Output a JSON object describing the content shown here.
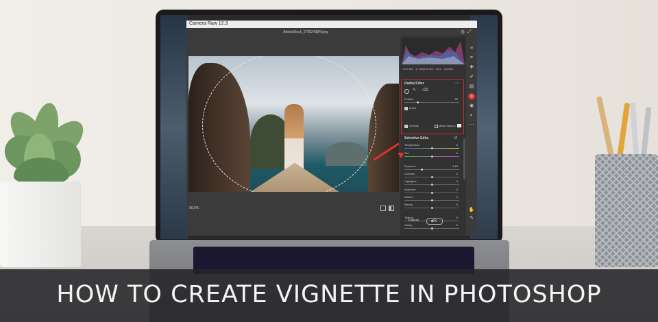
{
  "banner": {
    "title": "HOW TO CREATE VIGNETTE IN PHOTOSHOP"
  },
  "window": {
    "title": "Camera Raw 12.3",
    "filename": "AdobeStock_270524384.jpeg"
  },
  "meta": {
    "iso": "ISO 400",
    "lens": "17-40@28 mm",
    "aperture": "f/5.6",
    "shutter": "1/1250s"
  },
  "radial_filter": {
    "title": "Radial Filter",
    "feather_label": "Feather",
    "feather_value": "20",
    "invert_label": "Invert",
    "overlay_label": "Overlay",
    "mask_options_label": "Mask Options"
  },
  "selective_edits": {
    "title": "Selective Edits",
    "rows": [
      {
        "label": "Temperature",
        "value": "0"
      },
      {
        "label": "Tint",
        "value": "0"
      },
      {
        "label": "Exposure",
        "value": "-1.15"
      },
      {
        "label": "Contrast",
        "value": "0"
      },
      {
        "label": "Highlights",
        "value": "0"
      },
      {
        "label": "Shadows",
        "value": "0"
      },
      {
        "label": "Whites",
        "value": "0"
      },
      {
        "label": "Blacks",
        "value": "0"
      },
      {
        "label": "Texture",
        "value": "0"
      },
      {
        "label": "Clarity",
        "value": "0"
      }
    ]
  },
  "zoom": {
    "value": "56.6%"
  },
  "buttons": {
    "cancel": "Cancel",
    "ok": "OK"
  },
  "colors": {
    "accent_red": "#d02a2a",
    "dialog_bg": "#3b3b3b",
    "panel_bg": "#323232"
  }
}
